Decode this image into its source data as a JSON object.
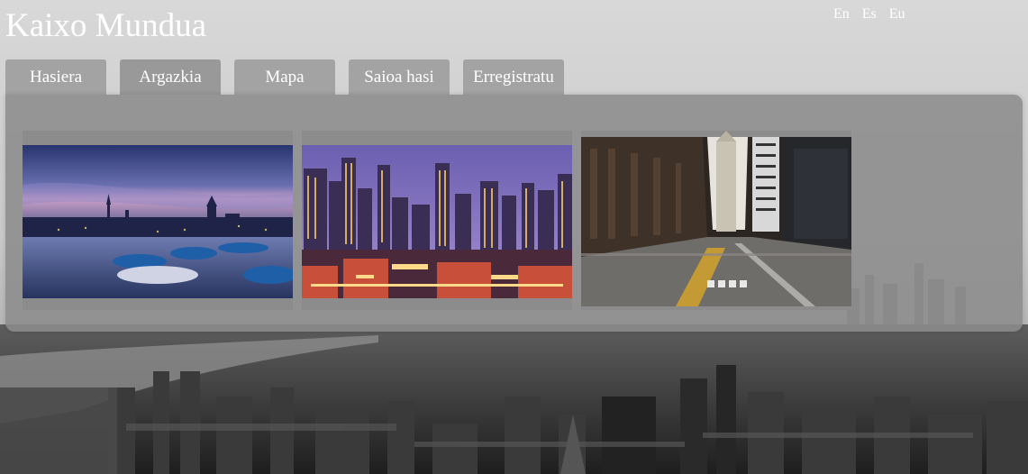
{
  "header": {
    "title": "Kaixo Mundua"
  },
  "languages": [
    {
      "label": "En"
    },
    {
      "label": "Es"
    },
    {
      "label": "Eu"
    }
  ],
  "nav": {
    "tabs": [
      {
        "label": "Hasiera",
        "active": false
      },
      {
        "label": "Argazkia",
        "active": true
      },
      {
        "label": "Mapa",
        "active": false
      },
      {
        "label": "Saioa hasi",
        "active": false
      },
      {
        "label": "Erregistratu",
        "active": false
      }
    ]
  },
  "gallery": {
    "photos": [
      {
        "subject": "harbor-at-dusk"
      },
      {
        "subject": "city-skyline-at-night"
      },
      {
        "subject": "downtown-street"
      }
    ]
  },
  "colors": {
    "panel": "#8c8c8c",
    "tab": "#a3a3a3",
    "text": "#ffffff"
  }
}
